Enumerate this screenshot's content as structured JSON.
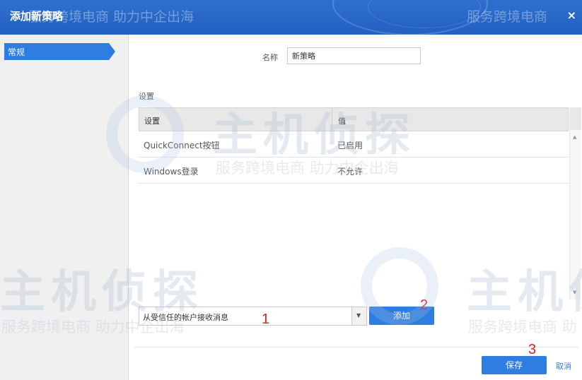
{
  "dialog": {
    "title": "添加新策略",
    "close_glyph": "×"
  },
  "watermark": {
    "brand": "主机侦探",
    "slogan_a": "服务跨境电商 助力中企出海",
    "slogan_b": "服务跨境电商 助力中企出海",
    "slogan_c": "服务跨境电商 助力中企出海",
    "slogan_d": "服务跨境电商",
    "slogan_e": "服务跨境电商 助",
    "slogan_f": "服务跨境电商 助力中企出海"
  },
  "sidebar": {
    "items": [
      {
        "label": "常规",
        "selected": true
      }
    ]
  },
  "form": {
    "name_label": "名称",
    "name_value": "新策略",
    "section_label": "设置"
  },
  "settings_table": {
    "columns": [
      "设置",
      "值"
    ],
    "rows": [
      {
        "setting": "QuickConnect按钮",
        "value": "已启用"
      },
      {
        "setting": "Windows登录",
        "value": "不允许"
      }
    ]
  },
  "add_control": {
    "selected_option": "从受信任的帐户接收消息",
    "add_label": "添加"
  },
  "footer": {
    "save_label": "保存",
    "cancel_label": "取消"
  },
  "annotations": [
    "1",
    "2",
    "3"
  ],
  "colors": {
    "accent": "#2e7de0",
    "titlebar": "#2261c2",
    "annotation": "#dd2222"
  },
  "icons": {
    "dropdown": "chevron-down-icon",
    "close": "close-icon"
  }
}
